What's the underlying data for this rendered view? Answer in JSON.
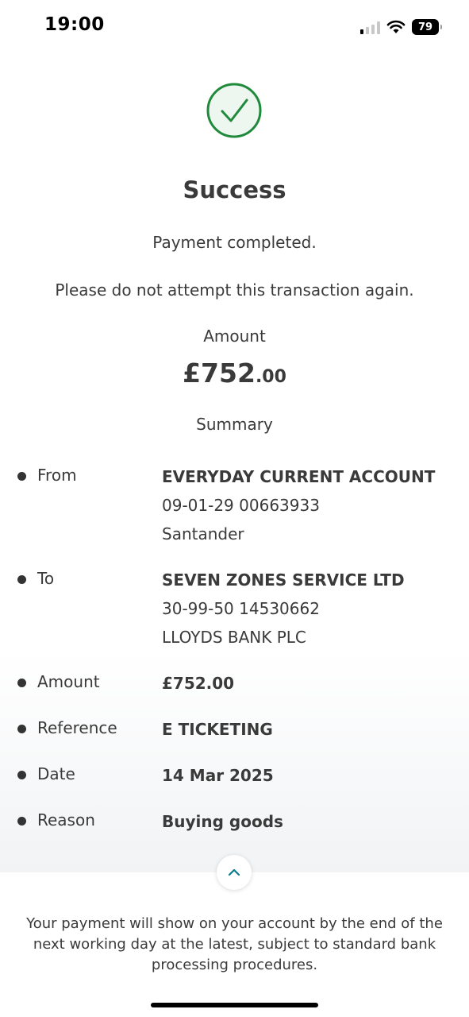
{
  "status_bar": {
    "time": "19:00",
    "battery_percent": "79",
    "signal_bars_active": 1,
    "signal_bars_total": 4,
    "icons": [
      "cellular-signal-icon",
      "wifi-icon",
      "battery-icon"
    ]
  },
  "result": {
    "icon": "check-circle-icon",
    "accent_color": "#1f8a3b",
    "title": "Success",
    "message": "Payment completed.",
    "warning": "Please do not attempt this transaction again."
  },
  "amount": {
    "label": "Amount",
    "pounds": "£752",
    "pence": ".00"
  },
  "summary": {
    "label": "Summary",
    "rows": [
      {
        "label": "From",
        "lines": [
          "EVERYDAY CURRENT ACCOUNT",
          "09-01-29 00663933",
          "Santander"
        ]
      },
      {
        "label": "To",
        "lines": [
          "SEVEN ZONES SERVICE LTD",
          "30-99-50 14530662",
          "LLOYDS BANK PLC"
        ]
      },
      {
        "label": "Amount",
        "lines": [
          "£752.00"
        ]
      },
      {
        "label": "Reference",
        "lines": [
          "E TICKETING"
        ]
      },
      {
        "label": "Date",
        "lines": [
          "14 Mar 2025"
        ]
      },
      {
        "label": "Reason",
        "lines": [
          "Buying goods"
        ]
      }
    ]
  },
  "collapse_toggle": {
    "icon": "chevron-up-icon",
    "color": "#0b7a8a"
  },
  "footer": {
    "note": "Your payment will show on your account by the end of the next working day at the latest, subject to standard bank processing procedures."
  }
}
